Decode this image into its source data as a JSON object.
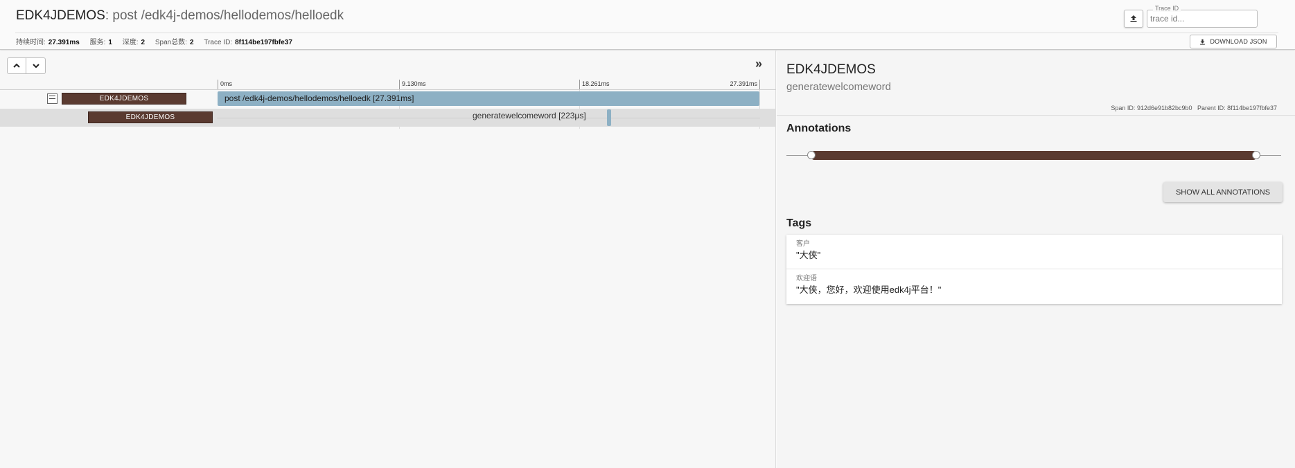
{
  "header": {
    "service": "EDK4JDEMOS",
    "separator": ":",
    "span_name": " post /edk4j-demos/hellodemos/helloedk",
    "trace_field_label": "Trace ID",
    "trace_field_placeholder": "trace id...",
    "download_label": "DOWNLOAD JSON",
    "upload_icon": "upload-icon",
    "meta": [
      {
        "key": "持续时间:",
        "value": "27.391ms"
      },
      {
        "key": "服务:",
        "value": "1"
      },
      {
        "key": "深度:",
        "value": "2"
      },
      {
        "key": "Span总数:",
        "value": "2"
      },
      {
        "key": "Trace ID:",
        "value": "8f114be197fbfe37"
      }
    ]
  },
  "timeline": {
    "ticks": [
      "0ms",
      "9.130ms",
      "18.261ms",
      "27.391ms"
    ],
    "expand_icon": "double-chevron-right-icon",
    "spans": [
      {
        "service": "EDK4JDEMOS",
        "label": "post /edk4j-demos/hellodemos/helloedk [27.391ms]",
        "start_fraction": 0.0,
        "duration_fraction": 1.0
      },
      {
        "service": "EDK4JDEMOS",
        "label": "generatewelcomeword [223μs]",
        "start_fraction": 0.708,
        "duration_fraction": 0.008
      }
    ]
  },
  "detail": {
    "service": "EDK4JDEMOS",
    "span_name": "generatewelcomeword",
    "span_id_label": "Span ID:",
    "span_id": "912d6e91b82bc9b0",
    "parent_id_label": "Parent ID:",
    "parent_id": "8f114be197fbfe37",
    "annotations_title": "Annotations",
    "show_all_label": "SHOW ALL ANNOTATIONS",
    "tags_title": "Tags",
    "tags": [
      {
        "key": "客户",
        "value": "\"大侠\""
      },
      {
        "key": "欢迎语",
        "value": "\"大侠，您好，欢迎使用edk4j平台！\""
      }
    ]
  },
  "colors": {
    "service_badge": "#5a3a30",
    "span_bar": "#8db0c4",
    "annotation_bar": "#5a3a30"
  }
}
